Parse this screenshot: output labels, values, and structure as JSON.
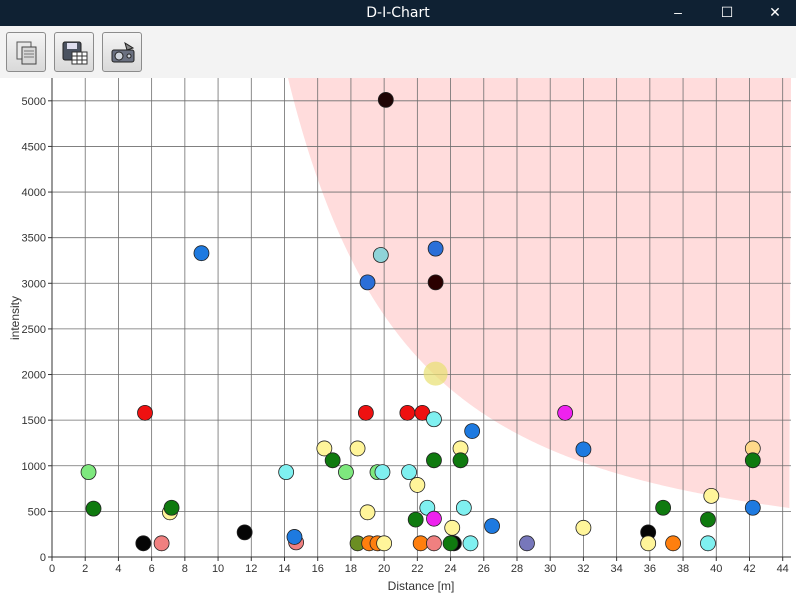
{
  "window": {
    "title": "D-I-Chart",
    "minimize_glyph": "–",
    "maximize_glyph": "☐",
    "close_glyph": "✕"
  },
  "toolbar": {
    "buttons": [
      {
        "icon": "copy-documents-icon"
      },
      {
        "icon": "save-table-icon"
      },
      {
        "icon": "export-device-icon"
      }
    ]
  },
  "colors": {
    "titlebar": "#0f2133",
    "danger_zone": "#ffdcdc",
    "grid": "#6e6e6e"
  },
  "chart_data": {
    "type": "scatter",
    "xlabel": "Distance [m]",
    "ylabel": "intensity",
    "xlim": [
      0,
      44.5
    ],
    "ylim": [
      0,
      5250
    ],
    "xticks": [
      0,
      2,
      4,
      6,
      8,
      10,
      12,
      14,
      16,
      18,
      20,
      22,
      24,
      26,
      28,
      30,
      32,
      34,
      36,
      38,
      40,
      42,
      44
    ],
    "yticks": [
      0,
      500,
      1000,
      1500,
      2000,
      2500,
      3000,
      3500,
      4000,
      4500,
      5000
    ],
    "grid": true,
    "shaded_region": {
      "description_boundary": "intensity above k / distance^2",
      "k": 1060000
    },
    "highlight": {
      "x": 23.1,
      "y": 2010,
      "color": "#e8e070"
    },
    "points": [
      {
        "x": 20.1,
        "y": 5010,
        "color": "#1f0505"
      },
      {
        "x": 9.0,
        "y": 3330,
        "color": "#1e7ae0"
      },
      {
        "x": 23.1,
        "y": 3380,
        "color": "#2b6fd8"
      },
      {
        "x": 19.8,
        "y": 3310,
        "color": "#8fd3d8"
      },
      {
        "x": 19.0,
        "y": 3010,
        "color": "#2b6fd8"
      },
      {
        "x": 23.1,
        "y": 3010,
        "color": "#2a0000"
      },
      {
        "x": 5.6,
        "y": 1580,
        "color": "#ee1111"
      },
      {
        "x": 18.9,
        "y": 1580,
        "color": "#ee1111"
      },
      {
        "x": 21.4,
        "y": 1580,
        "color": "#ee1111"
      },
      {
        "x": 22.3,
        "y": 1580,
        "color": "#ee1111"
      },
      {
        "x": 30.9,
        "y": 1580,
        "color": "#ee22ee"
      },
      {
        "x": 23.0,
        "y": 1510,
        "color": "#7ff0f0"
      },
      {
        "x": 25.3,
        "y": 1380,
        "color": "#1e7ae0"
      },
      {
        "x": 16.4,
        "y": 1190,
        "color": "#fff59a"
      },
      {
        "x": 18.4,
        "y": 1190,
        "color": "#fff59a"
      },
      {
        "x": 24.6,
        "y": 1190,
        "color": "#fff59a"
      },
      {
        "x": 32.0,
        "y": 1180,
        "color": "#1e7ae0"
      },
      {
        "x": 42.2,
        "y": 1190,
        "color": "#ffd98a"
      },
      {
        "x": 16.9,
        "y": 1060,
        "color": "#0f7a0f"
      },
      {
        "x": 23.0,
        "y": 1060,
        "color": "#0f7a0f"
      },
      {
        "x": 24.6,
        "y": 1060,
        "color": "#0f7a0f"
      },
      {
        "x": 42.2,
        "y": 1060,
        "color": "#0f7a0f"
      },
      {
        "x": 2.2,
        "y": 930,
        "color": "#7ee87e"
      },
      {
        "x": 14.1,
        "y": 930,
        "color": "#7ff0f0"
      },
      {
        "x": 17.7,
        "y": 930,
        "color": "#7ee87e"
      },
      {
        "x": 19.6,
        "y": 930,
        "color": "#7ee87e"
      },
      {
        "x": 19.9,
        "y": 930,
        "color": "#7ff0f0"
      },
      {
        "x": 21.5,
        "y": 930,
        "color": "#7ff0f0"
      },
      {
        "x": 22.0,
        "y": 790,
        "color": "#fff59a"
      },
      {
        "x": 39.7,
        "y": 670,
        "color": "#fff59a"
      },
      {
        "x": 2.5,
        "y": 530,
        "color": "#0f7a0f"
      },
      {
        "x": 7.1,
        "y": 490,
        "color": "#fff59a"
      },
      {
        "x": 7.2,
        "y": 540,
        "color": "#0f7a0f"
      },
      {
        "x": 19.0,
        "y": 490,
        "color": "#fff59a"
      },
      {
        "x": 22.6,
        "y": 540,
        "color": "#7ff0f0"
      },
      {
        "x": 24.8,
        "y": 540,
        "color": "#7ff0f0"
      },
      {
        "x": 36.8,
        "y": 540,
        "color": "#0f7a0f"
      },
      {
        "x": 42.2,
        "y": 540,
        "color": "#1e7ae0"
      },
      {
        "x": 21.9,
        "y": 410,
        "color": "#0f7a0f"
      },
      {
        "x": 23.0,
        "y": 420,
        "color": "#ee22ee"
      },
      {
        "x": 39.5,
        "y": 410,
        "color": "#0f7a0f"
      },
      {
        "x": 24.1,
        "y": 320,
        "color": "#fff59a"
      },
      {
        "x": 26.5,
        "y": 340,
        "color": "#1e7ae0"
      },
      {
        "x": 32.0,
        "y": 320,
        "color": "#fff59a"
      },
      {
        "x": 11.6,
        "y": 270,
        "color": "#050505"
      },
      {
        "x": 35.9,
        "y": 270,
        "color": "#050505"
      },
      {
        "x": 14.7,
        "y": 160,
        "color": "#f08080"
      },
      {
        "x": 14.6,
        "y": 220,
        "color": "#1e7ae0"
      },
      {
        "x": 5.5,
        "y": 150,
        "color": "#050505"
      },
      {
        "x": 6.6,
        "y": 150,
        "color": "#f08080"
      },
      {
        "x": 18.4,
        "y": 150,
        "color": "#6b8e23"
      },
      {
        "x": 19.1,
        "y": 150,
        "color": "#ff7f0e"
      },
      {
        "x": 19.6,
        "y": 150,
        "color": "#ff7f0e"
      },
      {
        "x": 20.0,
        "y": 150,
        "color": "#fff59a"
      },
      {
        "x": 22.2,
        "y": 150,
        "color": "#ff7f0e"
      },
      {
        "x": 23.0,
        "y": 150,
        "color": "#f08080"
      },
      {
        "x": 24.2,
        "y": 150,
        "color": "#050505"
      },
      {
        "x": 24.0,
        "y": 150,
        "color": "#0f7a0f"
      },
      {
        "x": 25.2,
        "y": 150,
        "color": "#7ff0f0"
      },
      {
        "x": 28.6,
        "y": 150,
        "color": "#7777bb"
      },
      {
        "x": 35.9,
        "y": 150,
        "color": "#fff59a"
      },
      {
        "x": 37.4,
        "y": 150,
        "color": "#ff7f0e"
      },
      {
        "x": 39.5,
        "y": 150,
        "color": "#7ff0f0"
      }
    ]
  }
}
